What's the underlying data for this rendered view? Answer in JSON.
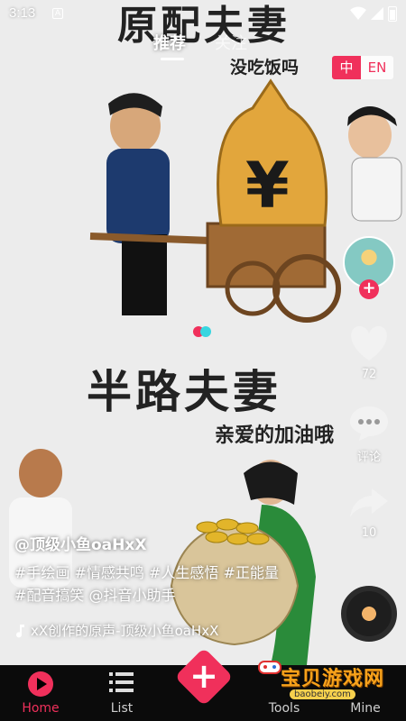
{
  "status_bar": {
    "time": "3:13",
    "notification": "A"
  },
  "top_tabs": [
    {
      "label": "推荐",
      "active": true
    },
    {
      "label": "关注",
      "active": false
    }
  ],
  "language_toggle": {
    "zh": "中",
    "en": "EN"
  },
  "video_overlay_text": {
    "top_title": "原配夫妻",
    "top_sub": "没吃饭吗",
    "mid_title": "半路夫妻",
    "mid_sub": "亲爱的加油哦"
  },
  "side_actions": {
    "like_count": "72",
    "comment_label": "评论",
    "share_count": "10"
  },
  "caption": {
    "author": "@顶级小鱼oaHxX",
    "description_line1": "#手绘画 #情感共鸣 #人生感悟 #正能量",
    "description_line2": "#配音搞笑 @抖音小助手",
    "music": "xX创作的原声-顶级小鱼oaHxX"
  },
  "bottom_nav": {
    "home": "Home",
    "list": "List",
    "tools": "Tools",
    "mine": "Mine"
  },
  "watermark": {
    "text": "宝贝游戏网",
    "url": "baobeiy.com"
  },
  "colors": {
    "accent": "#f0305b",
    "nav_bg": "#0b0b0b"
  }
}
